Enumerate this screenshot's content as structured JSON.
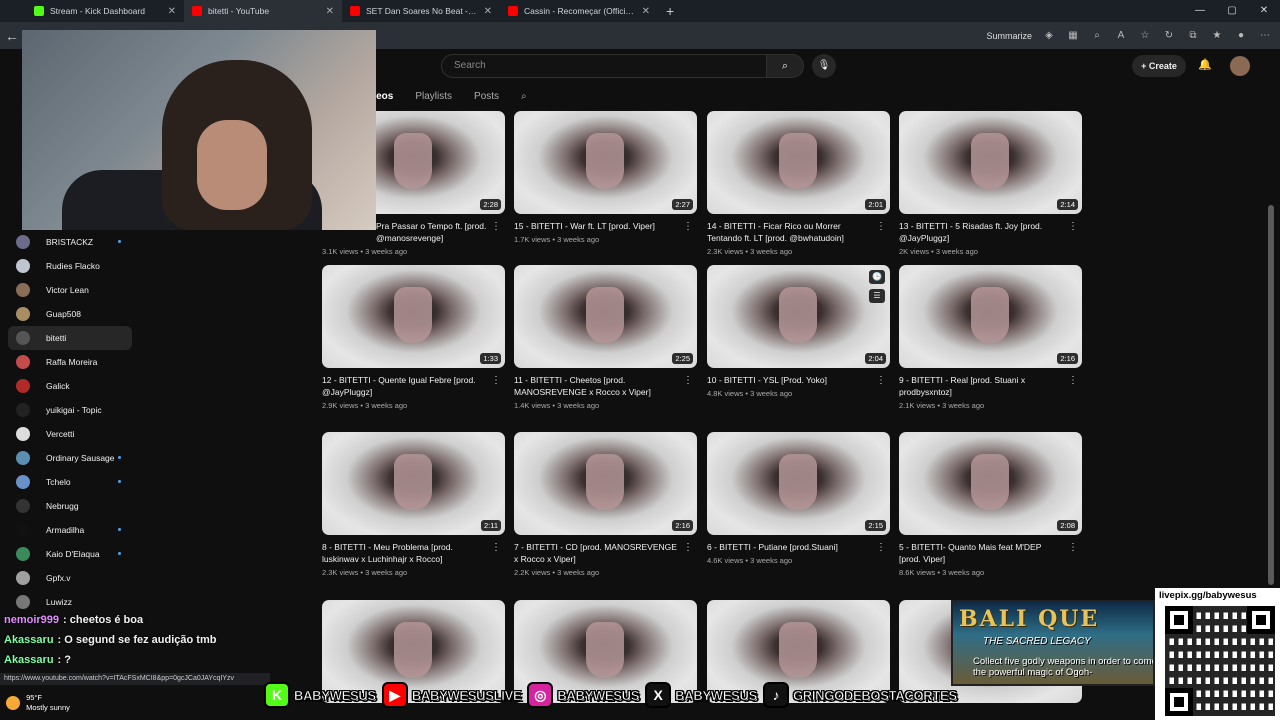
{
  "browser": {
    "tabs": [
      {
        "title": "Stream - Kick Dashboard",
        "color": "#53fc18",
        "active": false
      },
      {
        "title": "bitetti - YouTube",
        "color": "#ff0000",
        "active": true
      },
      {
        "title": "SET Dan Soares No Beat - MC'S G",
        "color": "#ff0000",
        "active": false
      },
      {
        "title": "Cassin - Recomeçar (Official Visu",
        "color": "#ff0000",
        "active": false
      }
    ],
    "summarize_label": "Summarize"
  },
  "youtube": {
    "search_placeholder": "Search",
    "create_label": "Create",
    "channel_tabs": [
      "deos",
      "Playlists",
      "Posts"
    ]
  },
  "sidebar": {
    "items": [
      {
        "name": "BRISTACKZ",
        "dot": true,
        "color": "#6b6b8a"
      },
      {
        "name": "Rudies Flacko",
        "dot": false,
        "color": "#c0c6d0"
      },
      {
        "name": "Victor Lean",
        "dot": false,
        "color": "#8a6d58"
      },
      {
        "name": "Guap508",
        "dot": false,
        "color": "#a98e64"
      },
      {
        "name": "bitetti",
        "dot": false,
        "color": "#555",
        "selected": true
      },
      {
        "name": "Raffa Moreira",
        "dot": false,
        "color": "#c24b4b"
      },
      {
        "name": "Galick",
        "dot": false,
        "color": "#b02a2a"
      },
      {
        "name": "yuikigai - Topic",
        "dot": false,
        "color": "#222"
      },
      {
        "name": "Vercetti",
        "dot": false,
        "color": "#ddd"
      },
      {
        "name": "Ordinary Sausage",
        "dot": true,
        "color": "#5a8fb0"
      },
      {
        "name": "Tchelo",
        "dot": true,
        "color": "#6a90c8"
      },
      {
        "name": "Nebrugg",
        "dot": false,
        "color": "#333"
      },
      {
        "name": "Armadilha",
        "dot": true,
        "color": "#111"
      },
      {
        "name": "Kaio D'Elaqua",
        "dot": true,
        "color": "#3a8a5a"
      },
      {
        "name": "Gpfx.v",
        "dot": false,
        "color": "#a0a0a0"
      },
      {
        "name": "Luwizz",
        "dot": false,
        "color": "#777"
      }
    ]
  },
  "videos": [
    {
      "title": "Pra Passar o Tempo ft. [prod. @manosrevenge]",
      "views": "3.1K views",
      "age": "3 weeks ago",
      "duration": "2:28"
    },
    {
      "title": "15 - BITETTI - War ft. LT [prod. Viper]",
      "views": "1.7K views",
      "age": "3 weeks ago",
      "duration": "2:27"
    },
    {
      "title": "14 - BITETTI - Ficar Rico ou Morrer Tentando ft. LT [prod. @bwhatudoin]",
      "views": "2.3K views",
      "age": "3 weeks ago",
      "duration": "2:01"
    },
    {
      "title": "13 - BITETTI - 5 Risadas ft. Joy [prod. @JayPluggz]",
      "views": "2K views",
      "age": "3 weeks ago",
      "duration": "2:14"
    },
    {
      "title": "12 - BITETTI - Quente Igual Febre [prod. @JayPluggz]",
      "views": "2.9K views",
      "age": "3 weeks ago",
      "duration": "1:33"
    },
    {
      "title": "11 - BITETTI - Cheetos [prod. MANOSREVENGE x Rocco x Viper]",
      "views": "1.4K views",
      "age": "3 weeks ago",
      "duration": "2:25"
    },
    {
      "title": "10 - BITETTI - YSL [Prod. Yoko]",
      "views": "4.8K views",
      "age": "3 weeks ago",
      "duration": "2:04",
      "hovered": true
    },
    {
      "title": "9 - BITETTI - Real [prod. Stuani x prodbysxntoz]",
      "views": "2.1K views",
      "age": "3 weeks ago",
      "duration": "2:16"
    },
    {
      "title": "8 - BITETTI - Meu Problema [prod. luskinwav x Luchinhajr x Rocco]",
      "views": "2.3K views",
      "age": "3 weeks ago",
      "duration": "2:11"
    },
    {
      "title": "7 - BITETTI - CD [prod. MANOSREVENGE x Rocco x Viper]",
      "views": "2.2K views",
      "age": "3 weeks ago",
      "duration": "2:16"
    },
    {
      "title": "6 - BITETTI - Putiane [prod.Stuani]",
      "views": "4.6K views",
      "age": "3 weeks ago",
      "duration": "2:15"
    },
    {
      "title": "5 - BITETTI- Quanto Mais feat M'DEP [prod. Viper]",
      "views": "8.6K views",
      "age": "3 weeks ago",
      "duration": "2:08"
    },
    {
      "title": "",
      "views": "",
      "age": "",
      "duration": ""
    },
    {
      "title": "",
      "views": "",
      "age": "",
      "duration": ""
    },
    {
      "title": "",
      "views": "",
      "age": "",
      "duration": ""
    },
    {
      "title": "",
      "views": "",
      "age": "",
      "duration": ""
    }
  ],
  "chat": [
    {
      "user": "nemoir999",
      "msg": ": cheetos é boa",
      "color": "purple"
    },
    {
      "user": "Akassaru",
      "msg": ": O segund se fez audição tmb",
      "color": "green"
    },
    {
      "user": "Akassaru",
      "msg": ": ?",
      "color": "green"
    }
  ],
  "status_url": "https://www.youtube.com/watch?v=ITAcFSxMCI8&pp=0gcJCa0JAYcqIYzv",
  "weather": {
    "temp": "95°F",
    "desc": "Mostly sunny"
  },
  "socials": [
    {
      "icon": "kick-icon",
      "glyph": "K",
      "bg": "#53fc18",
      "handle": "BABYWESUS"
    },
    {
      "icon": "youtube-icon",
      "glyph": "▶",
      "bg": "#ff0000",
      "handle": "BABYWESUSLIVE"
    },
    {
      "icon": "instagram-icon",
      "glyph": "◎",
      "bg": "#d6249f",
      "handle": "BABYWESUS"
    },
    {
      "icon": "x-icon",
      "glyph": "X",
      "bg": "#111",
      "handle": "BABYWESUS"
    },
    {
      "icon": "tiktok-icon",
      "glyph": "♪",
      "bg": "#111",
      "handle": "GRINGODEBOSTACORTES"
    }
  ],
  "ad": {
    "title": "BALI QUE",
    "subtitle": "THE SACRED LEGACY",
    "body": "Collect five godly weapons in order to come the powerful magic of Ogoh-"
  },
  "qr": {
    "label": "livepix.gg/babywesus"
  }
}
